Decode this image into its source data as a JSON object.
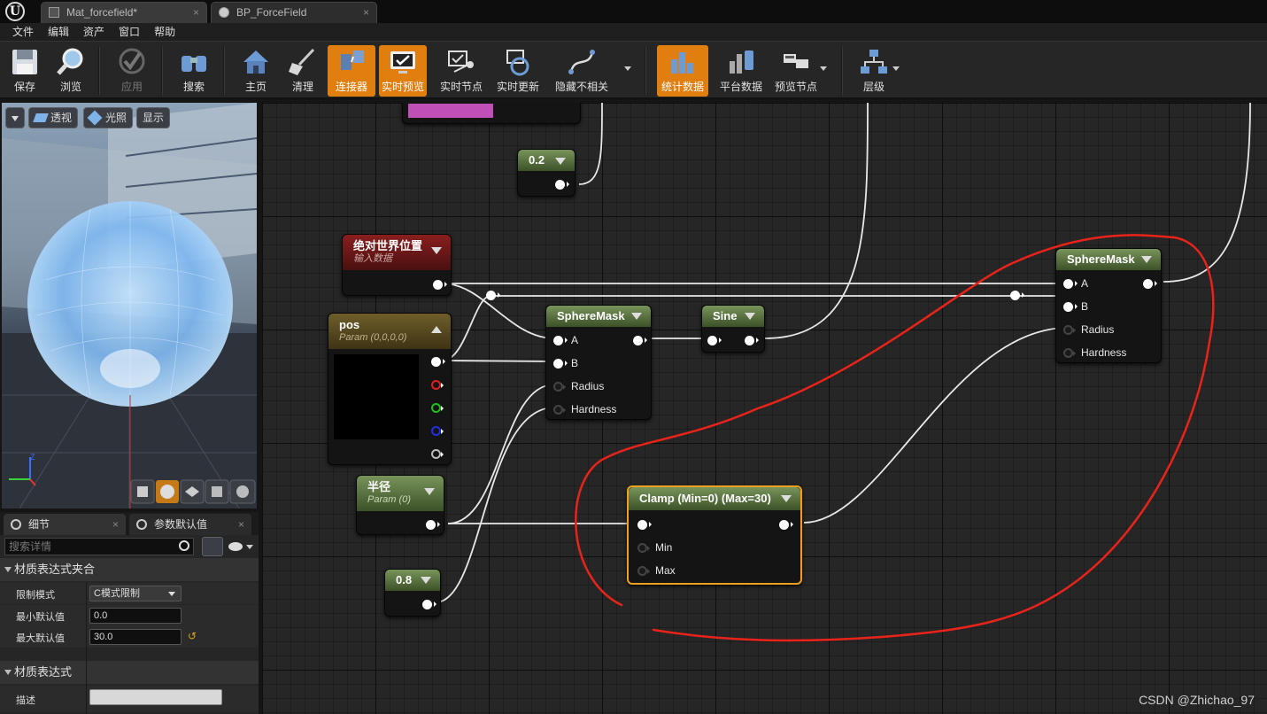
{
  "app": {
    "logo": "U"
  },
  "tabs": [
    {
      "label": "Mat_forcefield*",
      "close": "×"
    },
    {
      "label": "BP_ForceField",
      "close": "×"
    }
  ],
  "menu": [
    "文件",
    "编辑",
    "资产",
    "窗口",
    "帮助"
  ],
  "toolbar": {
    "save": "保存",
    "browse": "浏览",
    "apply": "应用",
    "search": "搜索",
    "home": "主页",
    "clean": "清理",
    "connector": "连接器",
    "live_preview": "实时预览",
    "live_nodes": "实时节点",
    "live_update": "实时更新",
    "hide_unrelated": "隐藏不相关",
    "stats": "统计数据",
    "platform_stats": "平台数据",
    "preview_node": "预览节点",
    "hierarchy": "层级"
  },
  "viewport": {
    "perspective": "透视",
    "lit": "光照",
    "show": "显示",
    "axis_z": "Z"
  },
  "details": {
    "tab_details": "细节",
    "tab_param_defaults": "参数默认值",
    "search_placeholder": "搜索详情",
    "section_clamp": "材质表达式夹合",
    "clamp_mode_label": "限制模式",
    "clamp_mode_value": "C模式限制",
    "min_label": "最小默认值",
    "min_value": "0.0",
    "max_label": "最大默认值",
    "max_value": "30.0",
    "section_expr": "材质表达式",
    "desc_label": "描述",
    "desc_value": ""
  },
  "graph": {
    "n_02": "0.2",
    "n_abswp_title": "绝对世界位置",
    "n_abswp_sub": "输入数据",
    "n_pos_title": "pos",
    "n_pos_sub": "Param (0,0,0,0)",
    "n_sm1_title": "SphereMask",
    "n_sine_title": "Sine",
    "n_sm2_title": "SphereMask",
    "pin_a": "A",
    "pin_b": "B",
    "pin_radius": "Radius",
    "pin_hardness": "Hardness",
    "n_radius_title": "半径",
    "n_radius_sub": "Param (0)",
    "n_clamp_title": "Clamp (Min=0) (Max=30)",
    "pin_min": "Min",
    "pin_max": "Max",
    "n_08": "0.8"
  },
  "watermark": "CSDN @Zhichao_97",
  "colors": {
    "accent": "#e07f10",
    "annotation": "#e8231a",
    "selected_node": "#f0a020"
  }
}
